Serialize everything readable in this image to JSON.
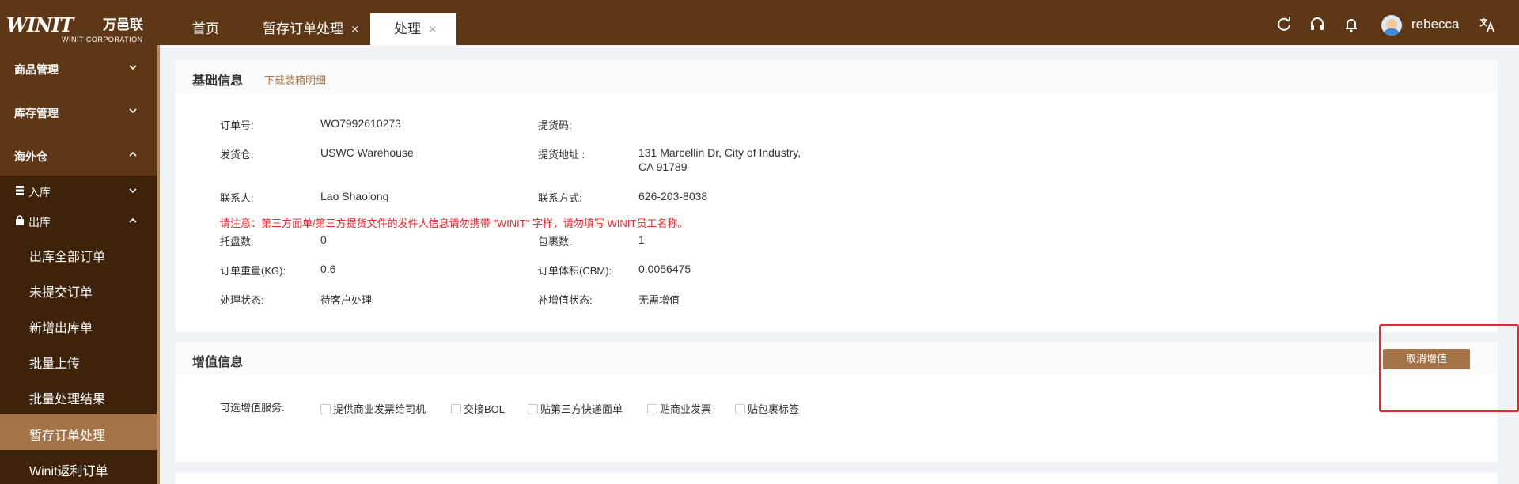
{
  "header": {
    "logo_mark": "WINIT",
    "logo_cn": "万邑联",
    "logo_sub": "WINIT CORPORATION",
    "tabs": [
      {
        "label": "首页",
        "closable": false
      },
      {
        "label": "暂存订单处理",
        "closable": true
      },
      {
        "label": "处理",
        "closable": true,
        "active": true
      }
    ],
    "close_glyph": "×",
    "icons": [
      "refresh-icon",
      "headset-icon",
      "bell-icon",
      "translate-icon"
    ],
    "username": "rebecca"
  },
  "sidebar": {
    "items": [
      {
        "label": "商品管理",
        "expanded": false
      },
      {
        "label": "库存管理",
        "expanded": false
      },
      {
        "label": "海外仓",
        "expanded": true
      },
      {
        "label": "入库",
        "expanded": false,
        "icon": "inbound-icon"
      },
      {
        "label": "出库",
        "expanded": true,
        "icon": "bag-icon"
      },
      {
        "label": "出库全部订单"
      },
      {
        "label": "未提交订单"
      },
      {
        "label": "新增出库单"
      },
      {
        "label": "批量上传"
      },
      {
        "label": "批量处理结果"
      },
      {
        "label": "暂存订单处理",
        "active": true
      },
      {
        "label": "Winit返利订单"
      }
    ]
  },
  "basic": {
    "title": "基础信息",
    "download_link": "下载装箱明细",
    "fields": {
      "order_no": {
        "label": "订单号:",
        "value": "WO7992610273"
      },
      "pickup_code": {
        "label": "提货码:",
        "value": ""
      },
      "warehouse": {
        "label": "发货仓:",
        "value": "USWC Warehouse"
      },
      "pickup_address": {
        "label": "提货地址 :",
        "value_line1": "131 Marcellin Dr, City of Industry,",
        "value_line2": "CA 91789"
      },
      "contact": {
        "label": "联系人:",
        "value": "Lao Shaolong"
      },
      "phone": {
        "label": "联系方式:",
        "value": "626-203-8038"
      },
      "pallets": {
        "label": "托盘数:",
        "value": "0"
      },
      "parcels": {
        "label": "包裹数:",
        "value": "1"
      },
      "weight": {
        "label": "订单重量(KG):",
        "value": "0.6"
      },
      "volume": {
        "label": "订单体积(CBM):",
        "value": "0.0056475"
      },
      "status": {
        "label": "处理状态:",
        "value": "待客户处理"
      },
      "vas_status": {
        "label": "补增值状态:",
        "value": "无需增值"
      }
    },
    "warning": "请注意：第三方面单/第三方提货文件的发件人信息请勿携带 \"WINIT\" 字样，请勿填写 WINIT员工名称。"
  },
  "vas": {
    "title": "增值信息",
    "cancel_button": "取消增值",
    "options_label": "可选增值服务:",
    "options": [
      {
        "label": "提供商业发票给司机",
        "checked": false
      },
      {
        "label": "交接BOL",
        "checked": false
      },
      {
        "label": "贴第三方快递面单",
        "checked": false
      },
      {
        "label": "贴商业发票",
        "checked": false
      },
      {
        "label": "贴包裹标签",
        "checked": false
      }
    ]
  },
  "colors": {
    "brand": "#5e3716",
    "accent": "#a47448",
    "warning": "#e8262b"
  }
}
